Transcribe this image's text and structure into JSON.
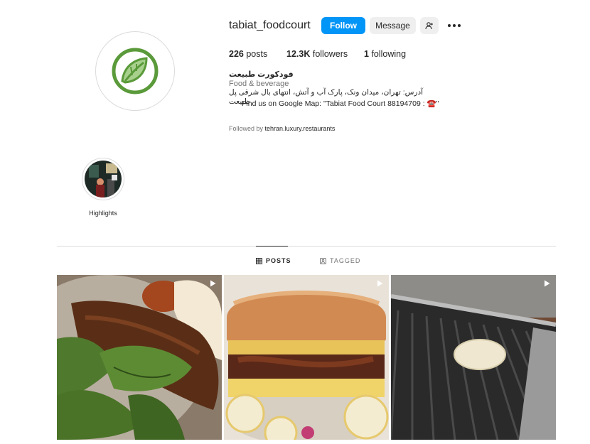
{
  "profile": {
    "username": "tabiat_foodcourt",
    "follow_label": "Follow",
    "message_label": "Message",
    "stats": {
      "posts_count": "226",
      "posts_label": "posts",
      "followers_count": "12.3K",
      "followers_label": "followers",
      "following_count": "1",
      "following_label": "following"
    },
    "full_name": "فودکورت طبیعت",
    "category": "Food & beverage",
    "bio_line1": "آدرس: تهران، میدان ونک، پارک آب و آتش، انتهای بال شرقی پل طبیعت",
    "bio_line2": "Find us on Google Map: \"Tabiat Food Court 88194709 : ☎️\"",
    "followed_by_prefix": "Followed by",
    "followed_by_user": "tehran.luxury.restaurants"
  },
  "highlights": [
    {
      "label": "Highlights"
    }
  ],
  "tabs": {
    "posts": "POSTS",
    "tagged": "TAGGED"
  },
  "colors": {
    "follow_button": "#0095f6",
    "secondary_button": "#efefef",
    "logo_green": "#5a9a3a",
    "logo_light_green": "#a8d08d"
  },
  "icons": [
    "logo-leaf-icon",
    "add-person-icon",
    "more-options-icon",
    "grid-icon",
    "tagged-icon",
    "reel-icon"
  ]
}
